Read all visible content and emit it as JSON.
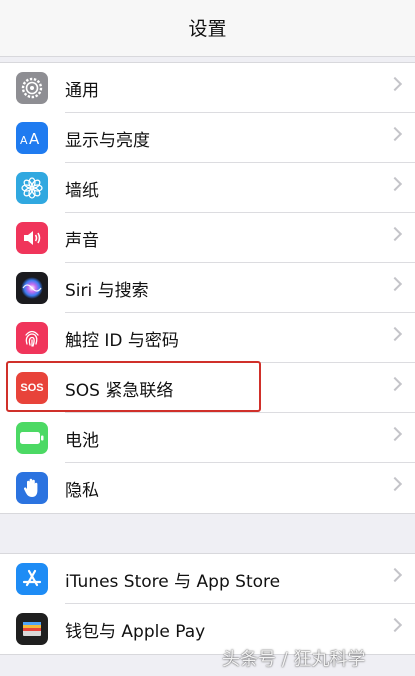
{
  "nav": {
    "title": "设置"
  },
  "group1": [
    {
      "label": "通用",
      "icon": "gear-icon",
      "color": "#8e8e93"
    },
    {
      "label": "显示与亮度",
      "icon": "display-aa-icon",
      "color": "#1f7bf0"
    },
    {
      "label": "墙纸",
      "icon": "wallpaper-flower-icon",
      "color": "#30a8e0"
    },
    {
      "label": "声音",
      "icon": "speaker-icon",
      "color": "#f0355b"
    },
    {
      "label": "Siri 与搜索",
      "icon": "siri-icon",
      "color": "#1b1b1f"
    },
    {
      "label": "触控 ID 与密码",
      "icon": "fingerprint-icon",
      "color": "#f0355b"
    },
    {
      "label": "SOS 紧急联络",
      "icon": "sos-icon",
      "icon_text": "SOS",
      "color": "#e8433a"
    },
    {
      "label": "电池",
      "icon": "battery-icon",
      "color": "#4cd964"
    },
    {
      "label": "隐私",
      "icon": "hand-icon",
      "color": "#2b73e0"
    }
  ],
  "group2": [
    {
      "label": "iTunes Store 与 App Store",
      "icon": "app-store-icon",
      "color": "#1e8cf5"
    },
    {
      "label": "钱包与 Apple Pay",
      "icon": "wallet-icon",
      "color": "#1f1f1f"
    }
  ],
  "highlight": {
    "color": "#d0302a"
  },
  "watermark": "头条号 / 狂丸科学"
}
